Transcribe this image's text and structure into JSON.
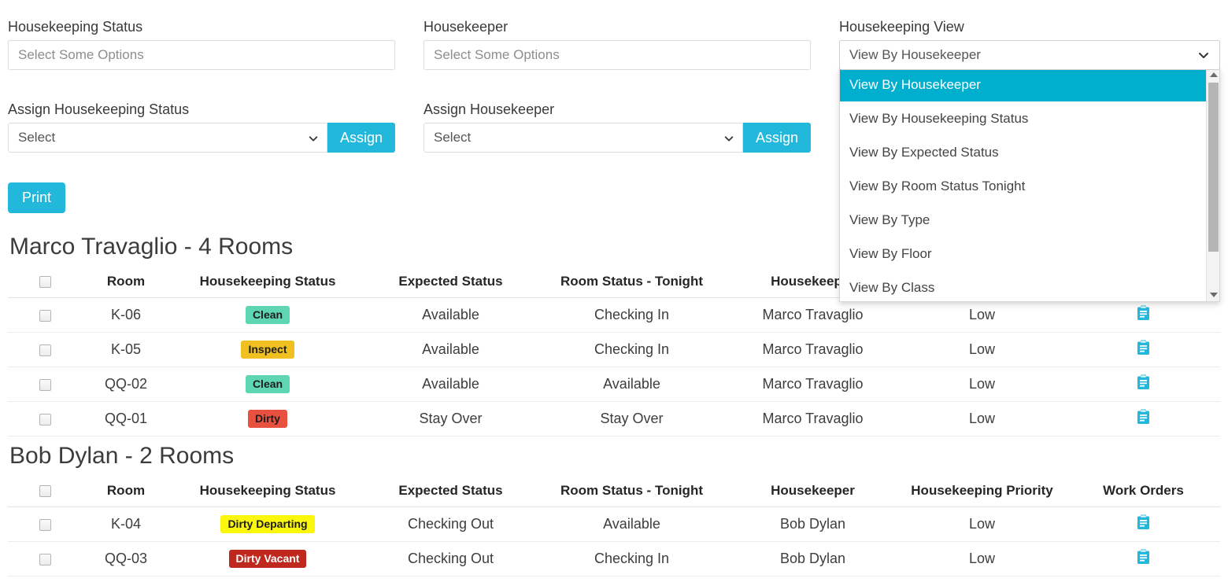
{
  "colors": {
    "accent": "#22b8dc",
    "dropdown_highlight": "#00aece",
    "badge_clean": "#5fd6b2",
    "badge_inspect": "#efc01f",
    "badge_dirty": "#e8503f",
    "badge_dirty_departing": "#fbf70c",
    "badge_dirty_vacant": "#c0271d",
    "work_order_icon": "#22b8dc"
  },
  "filters": {
    "housekeeping_status": {
      "label": "Housekeeping Status",
      "placeholder": "Select Some Options",
      "value": ""
    },
    "housekeeper": {
      "label": "Housekeeper",
      "placeholder": "Select Some Options",
      "value": ""
    },
    "housekeeping_view": {
      "label": "Housekeeping View",
      "value": "View By Housekeeper",
      "open": true,
      "options": [
        "View By Housekeeper",
        "View By Housekeeping Status",
        "View By Expected Status",
        "View By Room Status Tonight",
        "View By Type",
        "View By Floor",
        "View By Class"
      ],
      "selected_index": 0
    },
    "assign_housekeeping_status": {
      "label": "Assign Housekeeping Status",
      "value": "Select",
      "button_label": "Assign"
    },
    "assign_housekeeper": {
      "label": "Assign Housekeeper",
      "value": "Select",
      "button_label": "Assign"
    },
    "print_button": "Print"
  },
  "table_columns": [
    "",
    "Room",
    "Housekeeping Status",
    "Expected Status",
    "Room Status - Tonight",
    "Housekeeper",
    "Housekeeping Priority",
    "Work Orders"
  ],
  "groups": [
    {
      "title": "Marco Travaglio - 4 Rooms",
      "housekeeper": "Marco Travaglio",
      "room_count": 4,
      "rows": [
        {
          "room": "K-06",
          "housekeeping_status": "Clean",
          "status_kind": "clean",
          "expected_status": "Available",
          "room_status_tonight": "Checking In",
          "housekeeper": "Marco Travaglio",
          "priority": "Low",
          "work_order_icon": "clipboard-icon"
        },
        {
          "room": "K-05",
          "housekeeping_status": "Inspect",
          "status_kind": "inspect",
          "expected_status": "Available",
          "room_status_tonight": "Checking In",
          "housekeeper": "Marco Travaglio",
          "priority": "Low",
          "work_order_icon": "clipboard-icon"
        },
        {
          "room": "QQ-02",
          "housekeeping_status": "Clean",
          "status_kind": "clean",
          "expected_status": "Available",
          "room_status_tonight": "Available",
          "housekeeper": "Marco Travaglio",
          "priority": "Low",
          "work_order_icon": "clipboard-icon"
        },
        {
          "room": "QQ-01",
          "housekeeping_status": "Dirty",
          "status_kind": "dirty",
          "expected_status": "Stay Over",
          "room_status_tonight": "Stay Over",
          "housekeeper": "Marco Travaglio",
          "priority": "Low",
          "work_order_icon": "clipboard-icon"
        }
      ]
    },
    {
      "title": "Bob Dylan - 2 Rooms",
      "housekeeper": "Bob Dylan",
      "room_count": 2,
      "rows": [
        {
          "room": "K-04",
          "housekeeping_status": "Dirty Departing",
          "status_kind": "dirty-departing",
          "expected_status": "Checking Out",
          "room_status_tonight": "Available",
          "housekeeper": "Bob Dylan",
          "priority": "Low",
          "work_order_icon": "clipboard-icon"
        },
        {
          "room": "QQ-03",
          "housekeeping_status": "Dirty Vacant",
          "status_kind": "dirty-vacant",
          "expected_status": "Checking Out",
          "room_status_tonight": "Checking In",
          "housekeeper": "Bob Dylan",
          "priority": "Low",
          "work_order_icon": "clipboard-icon"
        }
      ]
    }
  ]
}
